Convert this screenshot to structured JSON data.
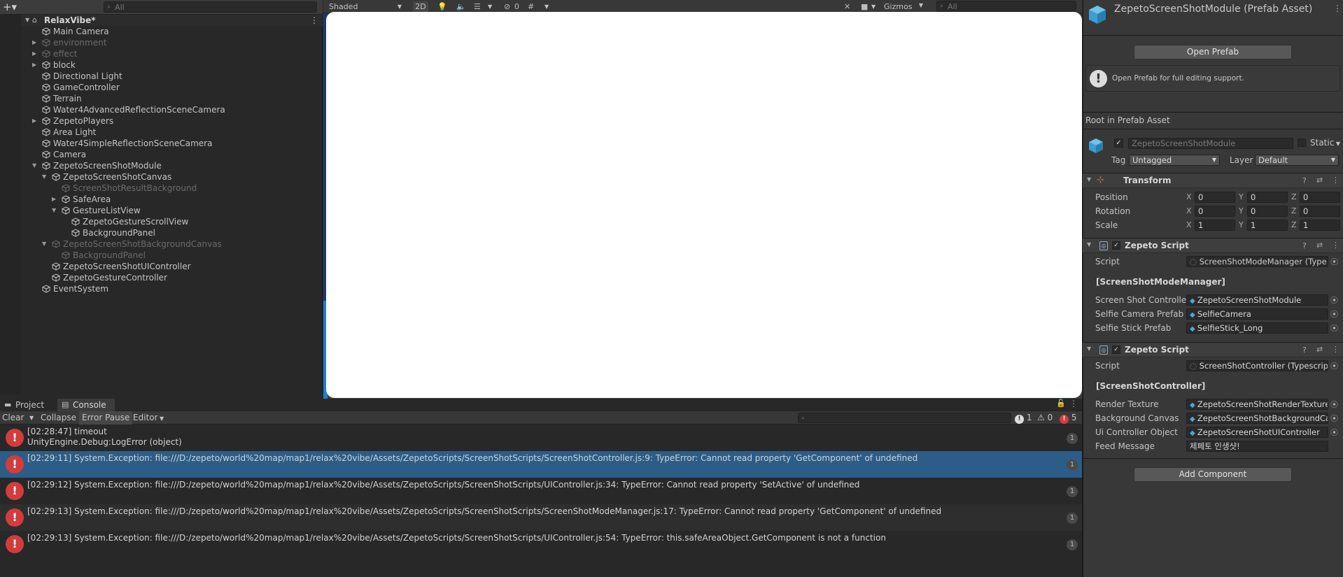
{
  "hierarchy": {
    "search_placeholder": "All",
    "scene_name": "RelaxVibe*",
    "items": [
      {
        "label": "Main Camera",
        "depth": 0,
        "arrow": "",
        "dim": false
      },
      {
        "label": "environment",
        "depth": 0,
        "arrow": "right",
        "dim": true
      },
      {
        "label": "effect",
        "depth": 0,
        "arrow": "right",
        "dim": true
      },
      {
        "label": "block",
        "depth": 0,
        "arrow": "right",
        "dim": false
      },
      {
        "label": "Directional Light",
        "depth": 0,
        "arrow": "",
        "dim": false
      },
      {
        "label": "GameController",
        "depth": 0,
        "arrow": "",
        "dim": false
      },
      {
        "label": "Terrain",
        "depth": 0,
        "arrow": "",
        "dim": false
      },
      {
        "label": "Water4AdvancedReflectionSceneCamera",
        "depth": 0,
        "arrow": "",
        "dim": false
      },
      {
        "label": "ZepetoPlayers",
        "depth": 0,
        "arrow": "right",
        "dim": false
      },
      {
        "label": "Area Light",
        "depth": 0,
        "arrow": "",
        "dim": false
      },
      {
        "label": "Water4SimpleReflectionSceneCamera",
        "depth": 0,
        "arrow": "",
        "dim": false
      },
      {
        "label": "Camera",
        "depth": 0,
        "arrow": "",
        "dim": false
      },
      {
        "label": "ZepetoScreenShotModule",
        "depth": 0,
        "arrow": "down",
        "dim": false
      },
      {
        "label": "ZepetoScreenShotCanvas",
        "depth": 1,
        "arrow": "down",
        "dim": false
      },
      {
        "label": "ScreenShotResultBackground",
        "depth": 2,
        "arrow": "",
        "dim": true
      },
      {
        "label": "SafeArea",
        "depth": 2,
        "arrow": "right",
        "dim": false
      },
      {
        "label": "GestureListView",
        "depth": 2,
        "arrow": "down",
        "dim": false
      },
      {
        "label": "ZepetoGestureScrollView",
        "depth": 3,
        "arrow": "",
        "dim": false
      },
      {
        "label": "BackgroundPanel",
        "depth": 3,
        "arrow": "",
        "dim": false
      },
      {
        "label": "ZepetoScreenShotBackgroundCanvas",
        "depth": 1,
        "arrow": "down",
        "dim": true
      },
      {
        "label": "BackgroundPanel",
        "depth": 2,
        "arrow": "",
        "dim": true
      },
      {
        "label": "ZepetoScreenShotUIController",
        "depth": 1,
        "arrow": "",
        "dim": false
      },
      {
        "label": "ZepetoGestureController",
        "depth": 1,
        "arrow": "",
        "dim": false
      },
      {
        "label": "EventSystem",
        "depth": 0,
        "arrow": "",
        "dim": false
      }
    ]
  },
  "scene": {
    "shading": "Shaded",
    "mode_2d": "2D",
    "hidden_count": "0",
    "gizmos": "Gizmos",
    "search_placeholder": "All"
  },
  "inspector": {
    "title": "ZepetoScreenShotModule (Prefab Asset)",
    "open_prefab": "Open Prefab",
    "info": "Open Prefab for full editing support.",
    "root_label": "Root in Prefab Asset",
    "object_name": "ZepetoScreenShotModule",
    "static_label": "Static",
    "tag_label": "Tag",
    "tag_value": "Untagged",
    "layer_label": "Layer",
    "layer_value": "Default",
    "transform": {
      "title": "Transform",
      "rows": [
        {
          "label": "Position",
          "x": "0",
          "y": "0",
          "z": "0"
        },
        {
          "label": "Rotation",
          "x": "0",
          "y": "0",
          "z": "0"
        },
        {
          "label": "Scale",
          "x": "1",
          "y": "1",
          "z": "1"
        }
      ],
      "axis_x": "X",
      "axis_y": "Y",
      "axis_z": "Z"
    },
    "script1": {
      "title": "Zepeto Script",
      "script_label": "Script",
      "script_value": "ScreenShotModeManager (Type",
      "class_name": "[ScreenShotModeManager]",
      "fields": [
        {
          "label": "Screen Shot Controller",
          "value": "ZepetoScreenShotModule"
        },
        {
          "label": "Selfie Camera Prefab",
          "value": "SelfieCamera"
        },
        {
          "label": "Selfie Stick Prefab",
          "value": "SelfieStick_Long"
        }
      ]
    },
    "script2": {
      "title": "Zepeto Script",
      "script_label": "Script",
      "script_value": "ScreenShotController (Typescrip",
      "class_name": "[ScreenShotController]",
      "fields": [
        {
          "label": "Render Texture",
          "value": "ZepetoScreenShotRenderTexture"
        },
        {
          "label": "Background Canvas",
          "value": "ZepetoScreenShotBackgroundCa"
        },
        {
          "label": "Ui Controller Object",
          "value": "ZepetoScreenShotUIController"
        },
        {
          "label": "Feed Message",
          "value": "제페토 인생샷!"
        }
      ]
    },
    "add_component": "Add Component"
  },
  "console": {
    "tab_project": "Project",
    "tab_console": "Console",
    "clear": "Clear",
    "collapse": "Collapse",
    "error_pause": "Error Pause",
    "editor": "Editor",
    "count_info": "1",
    "count_warn": "0",
    "count_error": "5",
    "logs": [
      {
        "line1": "[02:28:47] timeout",
        "line2": "UnityEngine.Debug:LogError (object)",
        "count": "1",
        "selected": false
      },
      {
        "line1": "[02:29:11] System.Exception: file:///D:/zepeto/world%20map/map1/relax%20vibe/Assets/ZepetoScripts/ScreenShotScripts/ScreenShotController.js:9: TypeError: Cannot read property 'GetComponent' of undefined",
        "line2": "",
        "count": "1",
        "selected": true
      },
      {
        "line1": "[02:29:12] System.Exception: file:///D:/zepeto/world%20map/map1/relax%20vibe/Assets/ZepetoScripts/ScreenShotScripts/UIController.js:34: TypeError: Cannot read property 'SetActive' of undefined",
        "line2": "",
        "count": "1",
        "selected": false
      },
      {
        "line1": "[02:29:13] System.Exception: file:///D:/zepeto/world%20map/map1/relax%20vibe/Assets/ZepetoScripts/ScreenShotScripts/ScreenShotModeManager.js:17: TypeError: Cannot read property 'GetComponent' of undefined",
        "line2": "",
        "count": "1",
        "selected": false
      },
      {
        "line1": "[02:29:13] System.Exception: file:///D:/zepeto/world%20map/map1/relax%20vibe/Assets/ZepetoScripts/ScreenShotScripts/UIController.js:54: TypeError: this.safeAreaObject.GetComponent is not a function",
        "line2": "",
        "count": "1",
        "selected": false
      }
    ]
  },
  "colors": {
    "accent": "#2c5d87",
    "error": "#d33c3c",
    "viewport": "#ffffff"
  }
}
